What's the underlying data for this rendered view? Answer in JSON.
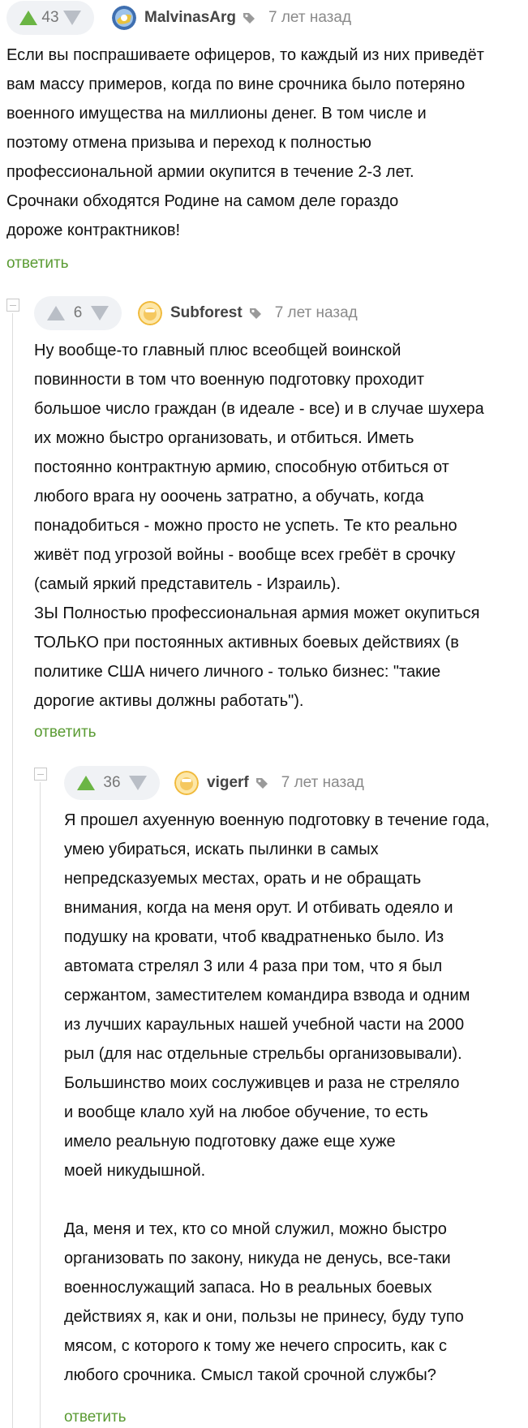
{
  "colors": {
    "upvote": "#6bb544",
    "downvote": "#b9bec6",
    "reply_link": "#5a9b33"
  },
  "icons": {
    "up": "triangle-up-icon",
    "down": "triangle-down-icon",
    "tag": "tag-icon",
    "collapse": "collapse-minus-icon"
  },
  "comments": [
    {
      "rating": "43",
      "author": "MalvinasArg",
      "time": "7 лет назад",
      "lines": [
        "Если вы поспрашиваете офицеров, то каждый из них приведёт",
        "вам массу примеров, когда по вине срочника было потеряно",
        "военного имущества на миллионы денег. В том числе и",
        "поэтому отмена призыва и переход к полностью",
        "профессиональной армии окупится в течение 2-3 лет.",
        "Срочнаки обходятся Родине на самом деле гораздо",
        "дороже контрактников!"
      ],
      "reply": "ответить"
    },
    {
      "rating": "6",
      "author": "Subforest",
      "time": "7 лет назад",
      "lines": [
        "Ну вообще-то главный плюс всеобщей воинской",
        "повинности в том что военную подготовку проходит",
        "большое число граждан (в идеале - все) и в случае шухера",
        "их можно быстро организовать, и отбиться. Иметь",
        "постоянно контрактную армию, способную отбиться от",
        "любого врага ну ooочень затратно, а обучать, когда",
        "понадобиться - можно просто не успеть. Те кто реально",
        "живёт под угрозой войны - вообще всех гребёт в срочку",
        "(самый яркий представитель - Израиль).",
        "ЗЫ Полностью профессиональная армия может окупиться",
        "ТОЛЬКО при постоянных активных боевых действиях (в",
        "политике США ничего личного - только бизнес: \"такие",
        "дорогие активы должны работать\")."
      ],
      "reply": "ответить"
    },
    {
      "rating": "36",
      "author": "vigerf",
      "time": "7 лет назад",
      "lines": [
        "Я прошел ахуенную военную подготовку в течение года,",
        "умею убираться, искать пылинки в самых",
        "непредсказуемых местах, орать и не обращать",
        "внимания, когда на меня орут. И отбивать одеяло и",
        "подушку на кровати, чтоб квадратненько было. Из",
        "автомата стрелял 3 или 4 раза при том, что я был",
        "сержантом, заместителем командира взвода и одним",
        "из лучших караульных нашей учебной части на 2000",
        "рыл (для нас отдельные стрельбы организовывали).",
        "Большинство моих сослуживцев и раза не стреляло",
        "и вообще клало хуй на любое обучение, то есть",
        "имело реальную подготовку даже еще хуже",
        "моей никудышной.",
        "",
        "Да, меня и тех, кто со мной служил, можно быстро",
        "организовать по закону, никуда не денусь, все-таки",
        "военнослужащий запаса. Но в реальных боевых",
        "действиях я, как и они, пользы не принесу, буду тупо",
        "мясом, с которого к тому же нечего спросить, как с",
        "любого срочника. Смысл такой срочной службы?"
      ],
      "reply": "ответить"
    }
  ]
}
